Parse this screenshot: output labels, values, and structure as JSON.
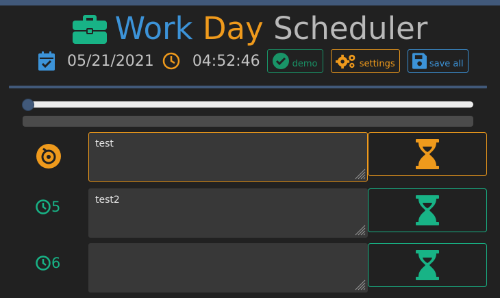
{
  "header": {
    "title_part1": "Work",
    "title_part2": "Day",
    "title_part3": "Scheduler",
    "date": "05/21/2021",
    "time": "04:52:46"
  },
  "buttons": {
    "demo": "demo",
    "settings": "settings",
    "save_all": "save all"
  },
  "progress": {
    "slider_position": 0,
    "bar_fill_fraction": 0
  },
  "rows": [
    {
      "hour": "",
      "text": "test",
      "state": "current",
      "icon": "hour-badge-current-icon"
    },
    {
      "hour": "5",
      "text": "test2",
      "state": "future",
      "icon": "clock-icon"
    },
    {
      "hour": "6",
      "text": "",
      "state": "future",
      "icon": "clock-icon"
    }
  ],
  "colors": {
    "blue": "#3c93d8",
    "orange": "#ef9a1c",
    "green": "#18b386",
    "gray": "#b9b9b9",
    "accent": "#41597a",
    "background": "#212121"
  }
}
